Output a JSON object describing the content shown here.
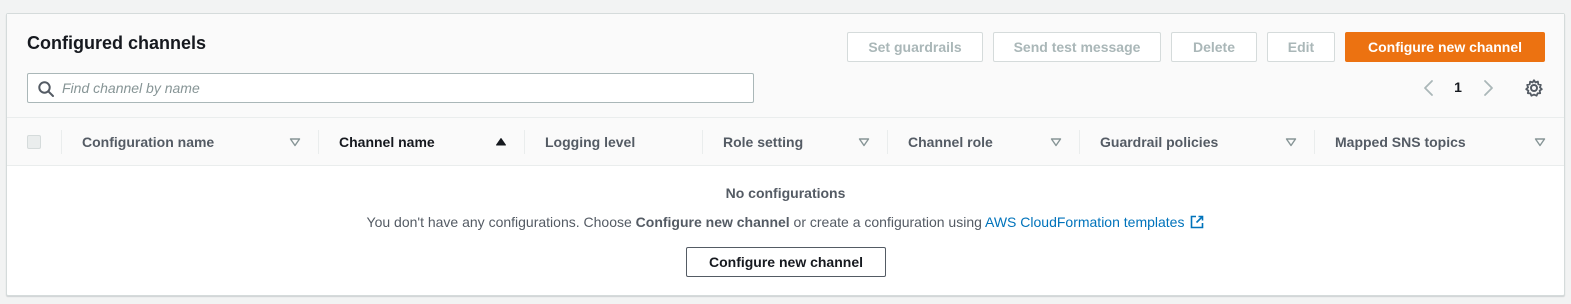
{
  "header": {
    "title": "Configured channels"
  },
  "toolbar": {
    "set_guardrails": "Set guardrails",
    "send_test_message": "Send test message",
    "delete": "Delete",
    "edit": "Edit",
    "configure_new_channel": "Configure new channel"
  },
  "search": {
    "placeholder": "Find channel by name",
    "value": ""
  },
  "pagination": {
    "current_page": "1"
  },
  "table": {
    "columns": [
      {
        "label": "Configuration name",
        "sort": "none"
      },
      {
        "label": "Channel name",
        "sort": "ascending"
      },
      {
        "label": "Logging level",
        "sort": "disabled"
      },
      {
        "label": "Role setting",
        "sort": "none"
      },
      {
        "label": "Channel role",
        "sort": "none"
      },
      {
        "label": "Guardrail policies",
        "sort": "none"
      },
      {
        "label": "Mapped SNS topics",
        "sort": "none"
      }
    ],
    "rows": []
  },
  "empty_state": {
    "title": "No configurations",
    "desc_prefix": "You don't have any configurations. Choose ",
    "desc_bold": "Configure new channel",
    "desc_middle": " or create a configuration using ",
    "desc_link": "AWS CloudFormation templates",
    "button_label": "Configure new channel"
  },
  "colors": {
    "primary_button": "#ec7211",
    "link": "#0073bb",
    "disabled_text": "#aab7b8"
  },
  "icons": {
    "search": "search-icon",
    "prev": "chevron-left-icon",
    "next": "chevron-right-icon",
    "settings": "gear-icon",
    "external": "external-link-icon",
    "sort_none": "caret-down-outline-icon",
    "sort_asc": "caret-up-filled-icon"
  }
}
